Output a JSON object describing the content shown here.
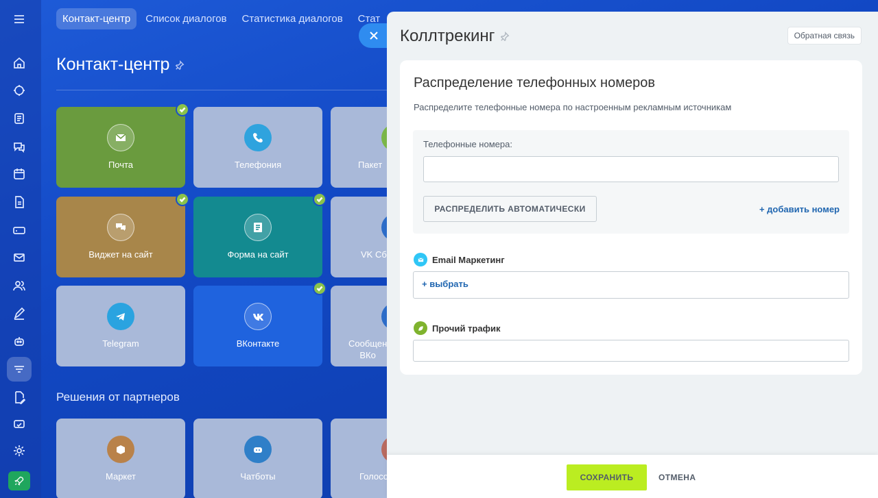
{
  "background": {
    "tabs": [
      {
        "label": "Контакт-центр",
        "active": true
      },
      {
        "label": "Список диалогов",
        "active": false
      },
      {
        "label": "Статистика диалогов",
        "active": false
      },
      {
        "label": "Стат",
        "active": false
      }
    ],
    "page_title": "Контакт-центр",
    "tiles": [
      {
        "label": "Почта",
        "icon": "mail-icon",
        "color": "#6a9b3e",
        "checked": true
      },
      {
        "label": "Телефония",
        "icon": "phone-icon",
        "color": "#9aaecf",
        "checked": false
      },
      {
        "label": "Пакет",
        "icon": "package-icon",
        "color": "#9aaecf",
        "checked": false
      },
      {
        "label": "Виджет на сайт",
        "icon": "chat-icon",
        "color": "#a8864a",
        "checked": true
      },
      {
        "label": "Форма на сайт",
        "icon": "form-icon",
        "color": "#138a90",
        "checked": true
      },
      {
        "label": "VK Сб",
        "icon": "vk-icon",
        "color": "#9aaecf",
        "checked": false
      },
      {
        "label": "Telegram",
        "icon": "telegram-icon",
        "color": "#9aaecf",
        "checked": false
      },
      {
        "label": "ВКонтакте",
        "icon": "vk-icon",
        "color": "#1f63de",
        "checked": true
      },
      {
        "label": "Сообщен\nВКо",
        "icon": "message-icon",
        "color": "#9aaecf",
        "checked": false
      },
      {
        "label": "Маркет",
        "icon": "market-icon",
        "color": "#9aaecf",
        "checked": false
      },
      {
        "label": "Чатботы",
        "icon": "bot-icon",
        "color": "#9aaecf",
        "checked": false
      },
      {
        "label": "Голосо",
        "icon": "voice-icon",
        "color": "#9aaecf",
        "checked": false
      }
    ],
    "partners_title": "Решения от партнеров"
  },
  "slider": {
    "title": "Коллтрекинг",
    "feedback_label": "Обратная связь",
    "card": {
      "title": "Распределение телефонных номеров",
      "subtitle": "Распределите телефонные номера по настроенным рекламным источникам",
      "phones_label": "Телефонные номера:",
      "phones_value": "",
      "auto_button": "РАСПРЕДЕЛИТЬ АВТОМАТИЧЕСКИ",
      "add_number": "+ добавить номер",
      "sources": [
        {
          "name": "Email Маркетинг",
          "icon": "email-marketing-icon",
          "color": "#2fc6f6",
          "action": "+  выбрать"
        },
        {
          "name": "Прочий трафик",
          "icon": "leaf-icon",
          "color": "#7fb32e",
          "action": ""
        }
      ]
    },
    "footer": {
      "save": "СОХРАНИТЬ",
      "cancel": "ОТМЕНА"
    }
  }
}
